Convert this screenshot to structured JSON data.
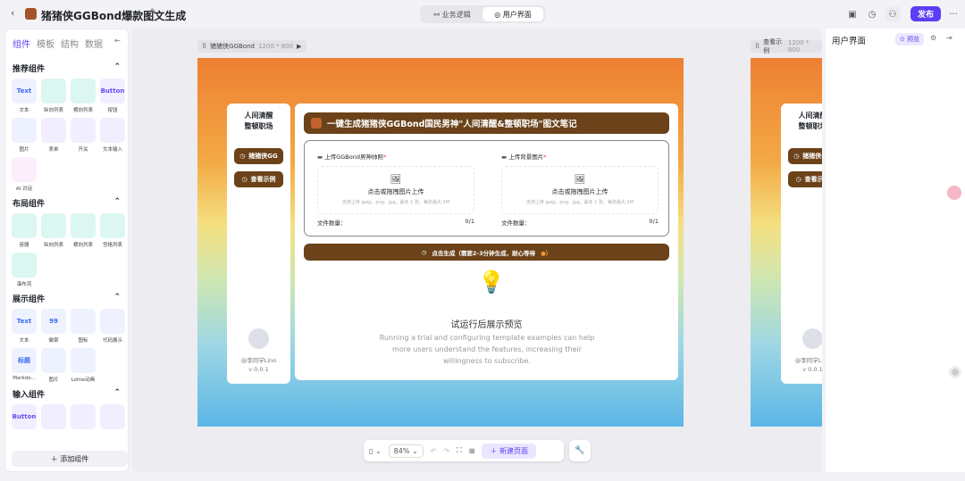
{
  "header": {
    "title": "猪猪侠GGBond爆款图文生成",
    "tabs": [
      "业务逻辑",
      "用户界面"
    ],
    "active_tab": 1,
    "publish": "发布"
  },
  "left_panel": {
    "tabs": [
      "组件",
      "模板",
      "结构",
      "数据"
    ],
    "sections": [
      {
        "title": "推荐组件",
        "items": [
          {
            "label": "文本",
            "icon": "Text"
          },
          {
            "label": "纵向列表",
            "icon": ""
          },
          {
            "label": "横向列表",
            "icon": ""
          },
          {
            "label": "按钮",
            "icon": "Button"
          },
          {
            "label": "图片",
            "icon": ""
          },
          {
            "label": "表单",
            "icon": ""
          },
          {
            "label": "开关",
            "icon": ""
          },
          {
            "label": "文本输入",
            "icon": ""
          },
          {
            "label": "AI 对话",
            "icon": ""
          }
        ]
      },
      {
        "title": "布局组件",
        "items": [
          {
            "label": "容器",
            "icon": ""
          },
          {
            "label": "纵向列表",
            "icon": ""
          },
          {
            "label": "横向列表",
            "icon": ""
          },
          {
            "label": "宫格列表",
            "icon": ""
          },
          {
            "label": "瀑布流",
            "icon": ""
          }
        ]
      },
      {
        "title": "展示组件",
        "items": [
          {
            "label": "文本",
            "icon": "Text"
          },
          {
            "label": "徽章",
            "icon": "99"
          },
          {
            "label": "图标",
            "icon": ""
          },
          {
            "label": "代码展示",
            "icon": ""
          },
          {
            "label": "Markdo...",
            "icon": "标题"
          },
          {
            "label": "图片",
            "icon": ""
          },
          {
            "label": "Lottie动画",
            "icon": ""
          }
        ]
      },
      {
        "title": "输入组件",
        "items": [
          {
            "label": "",
            "icon": "Button"
          },
          {
            "label": "",
            "icon": ""
          },
          {
            "label": "",
            "icon": ""
          },
          {
            "label": "",
            "icon": ""
          }
        ]
      }
    ],
    "add_button": "添加组件"
  },
  "canvas": {
    "frame1": {
      "name": "猪猪侠GGBond",
      "size": "1200 * 800"
    },
    "frame2": {
      "name": "查看示例",
      "size": "1200 * 800"
    },
    "app": {
      "brand_line1": "人间清醒",
      "brand_line2": "整顿职场",
      "nav": [
        "猪猪侠GG",
        "查看示例"
      ],
      "user": "@李同学Lino",
      "version": "v 0.0.1",
      "heading": "一键生成猪猪侠GGBond国民男神\"人间清醒&整顿职场\"图文笔记",
      "uploads": [
        {
          "label": "上传GGBond男神帅照",
          "drop": "点击或拖拽图片上传",
          "hint": "支持上传 jpeg、png、jpg，最多 1 张，每张最大 1M",
          "count_label": "文件数量：",
          "count": "0/1"
        },
        {
          "label": "上传背景图片",
          "drop": "点击或拖拽图片上传",
          "hint": "支持上传 jpeg、png、jpg，最多 1 张，每张最大 1M",
          "count_label": "文件数量：",
          "count": "0/1"
        }
      ],
      "generate": "点击生成（需要2-3分钟生成，耐心等待",
      "preview_title": "试运行后展示预览",
      "preview_desc": "Running a trial and configuring template examples can help more users understand the features, increasing their willingness to subscribe."
    }
  },
  "toolbar": {
    "zoom": "84%",
    "new_page": "新建页面"
  },
  "right_panel": {
    "title": "用户界面",
    "preview": "预览"
  }
}
